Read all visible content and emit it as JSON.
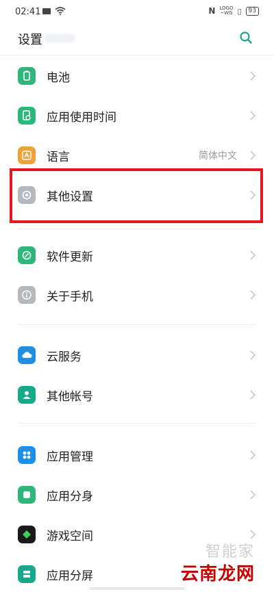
{
  "status": {
    "time": "02:41",
    "logo_top": "LOGO",
    "logo_bottom": "~WG",
    "battery": "93"
  },
  "header": {
    "title": "设置"
  },
  "rows": [
    {
      "label": "电池",
      "value": ""
    },
    {
      "label": "应用使用时间",
      "value": ""
    },
    {
      "label": "语言",
      "value": "简体中文"
    },
    {
      "label": "其他设置",
      "value": ""
    },
    {
      "label": "软件更新",
      "value": ""
    },
    {
      "label": "关于手机",
      "value": ""
    },
    {
      "label": "云服务",
      "value": ""
    },
    {
      "label": "其他帐号",
      "value": ""
    },
    {
      "label": "应用管理",
      "value": ""
    },
    {
      "label": "应用分身",
      "value": ""
    },
    {
      "label": "游戏空间",
      "value": ""
    },
    {
      "label": "应用分屏",
      "value": ""
    }
  ],
  "icons": [
    "battery-icon",
    "screen-time-icon",
    "language-icon",
    "other-settings-icon",
    "software-update-icon",
    "about-phone-icon",
    "cloud-icon",
    "account-icon",
    "app-management-icon",
    "app-clone-icon",
    "game-space-icon",
    "split-screen-icon"
  ],
  "colors": {
    "green": "#2fb67a",
    "orange": "#f0a23a",
    "gray": "#b5b8bd",
    "blue": "#1f8fe6",
    "teal": "#17a98a",
    "highlight": "#e4161f"
  },
  "watermark": {
    "top": "智能家",
    "bottom": "云南龙网"
  }
}
